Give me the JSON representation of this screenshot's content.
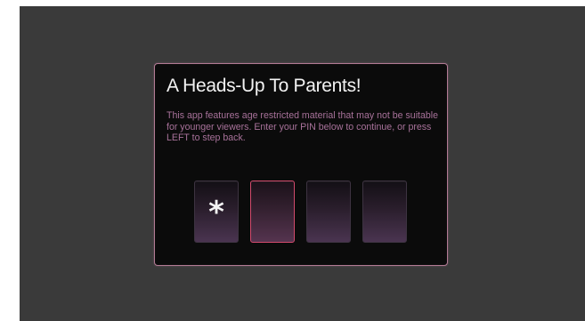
{
  "dialog": {
    "title": "A Heads-Up To Parents!",
    "message": "This app features age restricted material that may not be suitable for younger viewers.  Enter your PIN below to continue, or press LEFT to step back."
  },
  "pin": {
    "digits": [
      "*",
      "",
      "",
      ""
    ],
    "active_index": 1
  },
  "colors": {
    "background": "#3a3a3a",
    "dialog_background": "#0b0b0b",
    "dialog_border": "#b27a94",
    "title_text": "#f2f2f2",
    "message_text": "#a8729a",
    "active_box_border": "#d24a6c"
  }
}
